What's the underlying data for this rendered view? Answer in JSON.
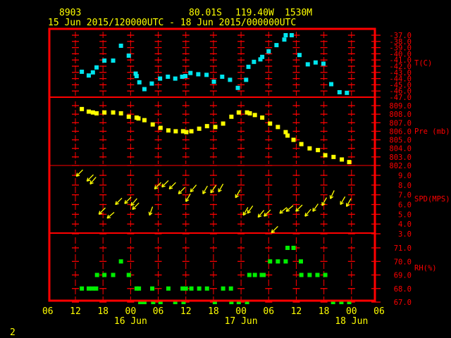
{
  "header": {
    "station_id": "8903",
    "latitude": "80.01S",
    "longitude": "119.40W",
    "elevation": "1530M",
    "time_range": "15 Jun 2015/120000UTC - 18 Jun 2015/000000UTC"
  },
  "footer": {
    "page_number": "2"
  },
  "colors": {
    "frame": "#ff0000",
    "temperature": "#00e5ee",
    "pressure": "#ffff00",
    "wind": "#ffff00",
    "rh": "#00ee00",
    "text": "#ffff00"
  },
  "chart_data": {
    "type": "scatter",
    "x_unit": "hours since 15 Jun 2015 12:00 UTC",
    "x_range": [
      -6,
      66
    ],
    "x_ticks": [
      {
        "h": -6,
        "label": "06"
      },
      {
        "h": 0,
        "label": "12"
      },
      {
        "h": 6,
        "label": "18"
      },
      {
        "h": 12,
        "label": "00"
      },
      {
        "h": 18,
        "label": "06"
      },
      {
        "h": 24,
        "label": "12"
      },
      {
        "h": 30,
        "label": "18"
      },
      {
        "h": 36,
        "label": "00"
      },
      {
        "h": 42,
        "label": "06"
      },
      {
        "h": 48,
        "label": "12"
      },
      {
        "h": 54,
        "label": "18"
      },
      {
        "h": 60,
        "label": "00"
      },
      {
        "h": 66,
        "label": "06"
      }
    ],
    "date_labels": [
      {
        "h": 12,
        "label": "16 Jun"
      },
      {
        "h": 36,
        "label": "17 Jun"
      },
      {
        "h": 60,
        "label": "18 Jun"
      }
    ],
    "panels": [
      {
        "name": "temperature",
        "label": "T(C)",
        "ylim": [
          -47,
          -37
        ],
        "tick_labels": [
          "-37.0",
          "-38.0",
          "-39.0",
          "-40.0",
          "-41.0",
          "-42.0",
          "-43.0",
          "-44.0",
          "-45.0",
          "-46.0",
          "-47.0"
        ],
        "tick_values": [
          -37,
          -38,
          -39,
          -40,
          -41,
          -42,
          -43,
          -44,
          -45,
          -46,
          -47
        ],
        "points": [
          [
            1.4,
            -42.9
          ],
          [
            2.9,
            -43.5
          ],
          [
            3.8,
            -43.0
          ],
          [
            4.6,
            -42.2
          ],
          [
            6.3,
            -41.1
          ],
          [
            8.2,
            -41.1
          ],
          [
            9.9,
            -38.7
          ],
          [
            11.6,
            -40.3
          ],
          [
            13.1,
            -43.2
          ],
          [
            13.3,
            -43.6
          ],
          [
            13.9,
            -44.6
          ],
          [
            15.0,
            -45.7
          ],
          [
            16.6,
            -44.8
          ],
          [
            18.4,
            -44.0
          ],
          [
            20.1,
            -43.7
          ],
          [
            21.7,
            -44.0
          ],
          [
            23.2,
            -43.7
          ],
          [
            23.9,
            -43.6
          ],
          [
            25.0,
            -43.1
          ],
          [
            26.7,
            -43.3
          ],
          [
            28.5,
            -43.4
          ],
          [
            30.1,
            -44.5
          ],
          [
            31.9,
            -43.7
          ],
          [
            33.6,
            -44.2
          ],
          [
            35.3,
            -45.5
          ],
          [
            37.1,
            -44.2
          ],
          [
            37.6,
            -42.1
          ],
          [
            38.8,
            -41.3
          ],
          [
            40.2,
            -40.9
          ],
          [
            40.6,
            -40.5
          ],
          [
            42.0,
            -39.6
          ],
          [
            43.7,
            -38.6
          ],
          [
            45.4,
            -37.7
          ],
          [
            45.7,
            -37.0
          ],
          [
            47.0,
            -37.0
          ],
          [
            48.7,
            -40.2
          ],
          [
            50.5,
            -41.7
          ],
          [
            52.2,
            -41.4
          ],
          [
            53.9,
            -41.6
          ],
          [
            55.6,
            -44.9
          ],
          [
            57.4,
            -46.2
          ],
          [
            59.0,
            -46.3
          ]
        ]
      },
      {
        "name": "pressure",
        "label": "Pre (mb)",
        "ylim": [
          802,
          809
        ],
        "tick_labels": [
          "809.0",
          "808.0",
          "807.0",
          "806.0",
          "805.0",
          "804.0",
          "803.0",
          "802.0"
        ],
        "tick_values": [
          809,
          808,
          807,
          806,
          805,
          804,
          803,
          802
        ],
        "points": [
          [
            1.4,
            808.6
          ],
          [
            2.9,
            808.3
          ],
          [
            3.8,
            808.2
          ],
          [
            4.6,
            808.1
          ],
          [
            6.3,
            808.2
          ],
          [
            8.2,
            808.2
          ],
          [
            9.9,
            808.1
          ],
          [
            11.6,
            807.7
          ],
          [
            13.3,
            807.6
          ],
          [
            13.7,
            807.5
          ],
          [
            15.0,
            807.3
          ],
          [
            16.8,
            806.8
          ],
          [
            18.5,
            806.4
          ],
          [
            20.2,
            806.1
          ],
          [
            21.8,
            806.0
          ],
          [
            23.4,
            806.0
          ],
          [
            24.1,
            805.9
          ],
          [
            25.2,
            806.0
          ],
          [
            26.9,
            806.3
          ],
          [
            28.6,
            806.6
          ],
          [
            30.4,
            806.5
          ],
          [
            32.1,
            806.9
          ],
          [
            33.9,
            807.7
          ],
          [
            35.5,
            808.2
          ],
          [
            37.3,
            808.2
          ],
          [
            37.9,
            808.1
          ],
          [
            39.0,
            807.9
          ],
          [
            40.6,
            807.6
          ],
          [
            42.3,
            806.9
          ],
          [
            44.0,
            806.5
          ],
          [
            45.7,
            805.9
          ],
          [
            46.1,
            805.5
          ],
          [
            47.4,
            805.0
          ],
          [
            49.1,
            804.5
          ],
          [
            50.9,
            804.0
          ],
          [
            52.7,
            803.8
          ],
          [
            54.3,
            803.2
          ],
          [
            56.1,
            803.0
          ],
          [
            57.9,
            802.7
          ],
          [
            59.5,
            802.4
          ]
        ]
      },
      {
        "name": "wind",
        "label": "SPD(MPS)",
        "ylim": [
          3,
          9
        ],
        "tick_labels": [
          "9.0",
          "8.0",
          "7.0",
          "6.0",
          "5.0",
          "4.0",
          "3.0"
        ],
        "tick_values": [
          9,
          8,
          7,
          6,
          5,
          4,
          3
        ],
        "points_note": "[hour, speed m/s, direction-from deg]",
        "points": [
          [
            0.2,
            8.9,
            45
          ],
          [
            2.5,
            8.4,
            45
          ],
          [
            3.2,
            8.1,
            40
          ],
          [
            5.1,
            5.0,
            45
          ],
          [
            6.9,
            4.6,
            50
          ],
          [
            8.7,
            6.0,
            45
          ],
          [
            10.7,
            6.1,
            45
          ],
          [
            12.1,
            5.9,
            40
          ],
          [
            12.4,
            5.5,
            45
          ],
          [
            16.1,
            4.9,
            20
          ],
          [
            17.2,
            7.6,
            45
          ],
          [
            18.8,
            7.8,
            45
          ],
          [
            20.4,
            7.6,
            45
          ],
          [
            22.4,
            7.1,
            45
          ],
          [
            24.0,
            6.3,
            30
          ],
          [
            25.0,
            7.3,
            40
          ],
          [
            27.7,
            7.1,
            30
          ],
          [
            29.4,
            7.2,
            35
          ],
          [
            31.1,
            7.3,
            30
          ],
          [
            34.8,
            6.7,
            30
          ],
          [
            36.5,
            4.9,
            30
          ],
          [
            37.4,
            5.1,
            35
          ],
          [
            39.7,
            4.7,
            40
          ],
          [
            41.0,
            4.8,
            45
          ],
          [
            42.6,
            3.1,
            45
          ],
          [
            44.4,
            5.1,
            50
          ],
          [
            45.8,
            5.3,
            50
          ],
          [
            47.9,
            5.3,
            45
          ],
          [
            49.9,
            4.8,
            40
          ],
          [
            51.6,
            5.3,
            35
          ],
          [
            53.6,
            5.9,
            30
          ],
          [
            55.4,
            6.6,
            25
          ],
          [
            57.6,
            6.0,
            30
          ],
          [
            58.9,
            5.8,
            30
          ]
        ]
      },
      {
        "name": "rh",
        "label": "RH(%)",
        "ylim": [
          67,
          71
        ],
        "tick_labels": [
          "71.0",
          "70.0",
          "69.0",
          "68.0",
          "67.0"
        ],
        "tick_values": [
          71,
          70,
          69,
          68,
          67
        ],
        "points": [
          [
            1.4,
            68
          ],
          [
            2.9,
            68
          ],
          [
            3.7,
            68
          ],
          [
            4.5,
            68
          ],
          [
            13.3,
            68
          ],
          [
            13.8,
            68
          ],
          [
            16.7,
            68
          ],
          [
            20.2,
            68
          ],
          [
            23.3,
            68
          ],
          [
            24.0,
            68
          ],
          [
            25.2,
            68
          ],
          [
            26.9,
            68
          ],
          [
            28.6,
            68
          ],
          [
            32.1,
            68
          ],
          [
            33.8,
            68
          ],
          [
            4.7,
            69
          ],
          [
            6.3,
            69
          ],
          [
            8.2,
            69
          ],
          [
            11.6,
            69
          ],
          [
            37.8,
            69
          ],
          [
            39.0,
            69
          ],
          [
            40.5,
            69
          ],
          [
            40.9,
            69
          ],
          [
            49.1,
            69
          ],
          [
            50.9,
            69
          ],
          [
            52.6,
            69
          ],
          [
            54.3,
            69
          ],
          [
            9.9,
            70
          ],
          [
            42.3,
            70
          ],
          [
            44.0,
            70
          ],
          [
            45.7,
            70
          ],
          [
            49.0,
            70
          ],
          [
            46.1,
            71
          ],
          [
            47.4,
            71
          ],
          [
            14.1,
            67
          ],
          [
            15.0,
            67
          ],
          [
            16.9,
            67
          ],
          [
            18.5,
            67
          ],
          [
            21.7,
            67
          ],
          [
            23.5,
            67
          ],
          [
            30.3,
            67
          ],
          [
            33.9,
            67
          ],
          [
            35.5,
            67
          ],
          [
            37.3,
            67
          ],
          [
            56.0,
            67
          ],
          [
            57.8,
            67
          ],
          [
            59.5,
            67
          ]
        ]
      }
    ]
  }
}
